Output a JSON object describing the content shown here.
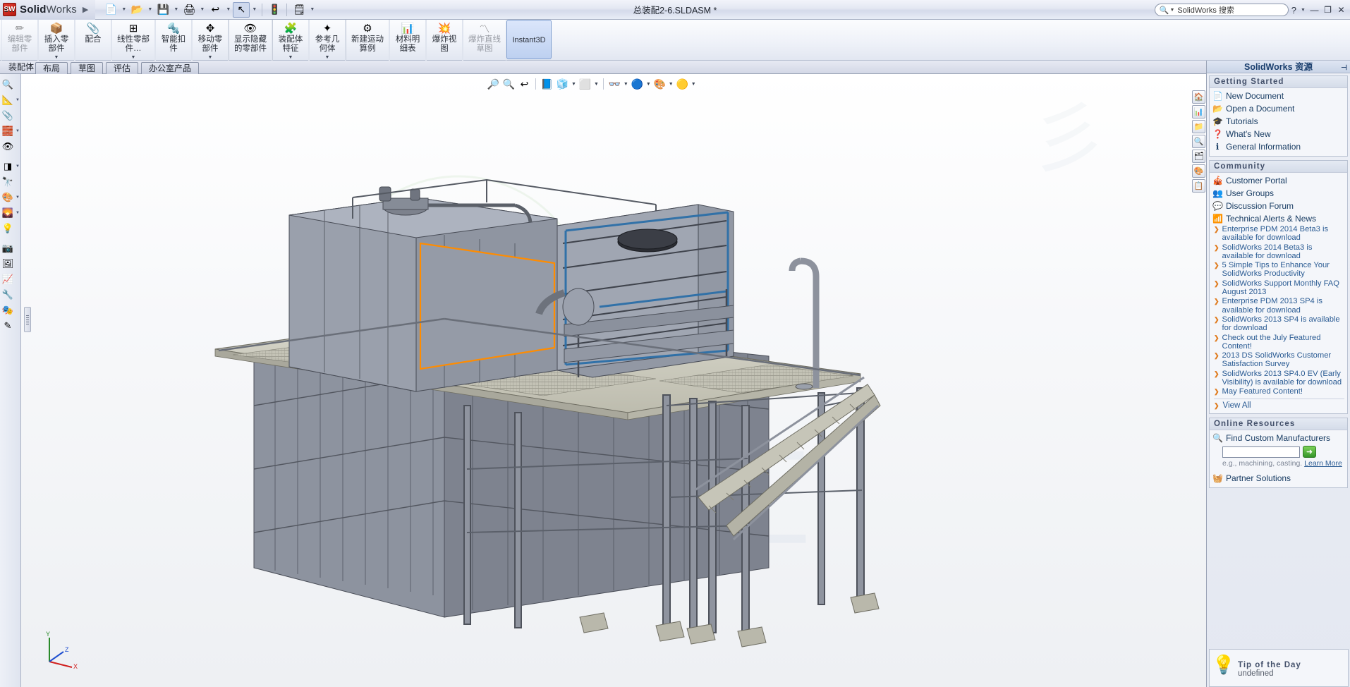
{
  "titlebar": {
    "brand_bold": "Solid",
    "brand_light": "Works",
    "brand_badge": "SW",
    "document_title": "总装配2-6.SLDASM *",
    "tools": [
      {
        "name": "new-document",
        "glyph": "📄",
        "caret": true
      },
      {
        "name": "open-document",
        "glyph": "📂",
        "caret": true
      },
      {
        "name": "save",
        "glyph": "💾",
        "caret": true
      },
      {
        "name": "print",
        "glyph": "🖨",
        "caret": true
      },
      {
        "name": "undo",
        "glyph": "↩",
        "caret": true
      },
      {
        "name": "select",
        "glyph": "↖",
        "caret": true
      },
      {
        "name": "rebuild",
        "glyph": "🚦",
        "caret": false
      },
      {
        "name": "options",
        "glyph": "🗒",
        "caret": true
      }
    ],
    "search_placeholder": "SolidWorks 搜索",
    "help_label": "?",
    "minimize": "—",
    "restore": "❐",
    "close": "✕"
  },
  "ribbon": {
    "items": [
      {
        "label": "编辑零部件",
        "icon": "✏",
        "dropdown": false,
        "disabled": true,
        "active": false
      },
      {
        "label": "插入零部件",
        "icon": "📦",
        "dropdown": true,
        "disabled": false,
        "active": false
      },
      {
        "label": "配合",
        "icon": "📎",
        "dropdown": false,
        "disabled": false,
        "active": false
      },
      {
        "label": "线性零部件…",
        "icon": "⊞",
        "dropdown": true,
        "disabled": false,
        "active": false
      },
      {
        "label": "智能扣件",
        "icon": "🔩",
        "dropdown": false,
        "disabled": false,
        "active": false
      },
      {
        "label": "移动零部件",
        "icon": "✥",
        "dropdown": true,
        "disabled": false,
        "active": false
      },
      {
        "label": "显示隐藏的零部件",
        "icon": "👁",
        "dropdown": false,
        "disabled": false,
        "active": false
      },
      {
        "label": "装配体特征",
        "icon": "🧩",
        "dropdown": true,
        "disabled": false,
        "active": false
      },
      {
        "label": "参考几何体",
        "icon": "✦",
        "dropdown": true,
        "disabled": false,
        "active": false
      },
      {
        "label": "新建运动算例",
        "icon": "⚙",
        "dropdown": false,
        "disabled": false,
        "active": false
      },
      {
        "label": "材料明细表",
        "icon": "📊",
        "dropdown": false,
        "disabled": false,
        "active": false
      },
      {
        "label": "爆炸视图",
        "icon": "💥",
        "dropdown": false,
        "disabled": false,
        "active": false
      },
      {
        "label": "爆炸直线草图",
        "icon": "〽",
        "dropdown": false,
        "disabled": true,
        "active": false
      },
      {
        "label": "Instant3D",
        "icon": "",
        "dropdown": false,
        "disabled": false,
        "active": true
      }
    ]
  },
  "tabs": [
    {
      "label": "装配体",
      "active": true
    },
    {
      "label": "布局",
      "active": false
    },
    {
      "label": "草图",
      "active": false
    },
    {
      "label": "评估",
      "active": false
    },
    {
      "label": "办公室产品",
      "active": false
    }
  ],
  "left_toolbar": [
    {
      "name": "filter-icon",
      "glyph": "🔍",
      "caret": false
    },
    {
      "name": "measure-icon",
      "glyph": "📐",
      "caret": true
    },
    {
      "name": "mate-icon",
      "glyph": "📎",
      "caret": false
    },
    {
      "name": "component-icon",
      "glyph": "🧱",
      "caret": true
    },
    {
      "name": "hidden-icon",
      "glyph": "👁",
      "caret": false
    },
    {
      "name": "section-icon",
      "glyph": "◨",
      "caret": true
    },
    {
      "name": "view-icon",
      "glyph": "🔭",
      "caret": false
    },
    {
      "name": "appearance-icon",
      "glyph": "🎨",
      "caret": true
    },
    {
      "name": "scene-icon",
      "glyph": "🌄",
      "caret": true
    },
    {
      "name": "light-icon",
      "glyph": "💡",
      "caret": false
    },
    {
      "name": "camera-icon",
      "glyph": "📷",
      "caret": false
    },
    {
      "name": "render-icon",
      "glyph": "🖼",
      "caret": false
    },
    {
      "name": "sim-icon",
      "glyph": "📈",
      "caret": false
    },
    {
      "name": "tool-icon",
      "glyph": "🔧",
      "caret": false
    },
    {
      "name": "palette-icon",
      "glyph": "🎭",
      "caret": false
    },
    {
      "name": "sketch-icon",
      "glyph": "✎",
      "caret": false
    }
  ],
  "view_toolbar": [
    {
      "name": "zoom-to-fit-icon",
      "glyph": "🔎",
      "caret": false
    },
    {
      "name": "zoom-to-area-icon",
      "glyph": "🔍",
      "caret": false
    },
    {
      "name": "previous-view-icon",
      "glyph": "↩",
      "caret": false
    },
    {
      "name": "section-view-icon",
      "glyph": "📘",
      "caret": false
    },
    {
      "name": "view-orientation-icon",
      "glyph": "🧊",
      "caret": true
    },
    {
      "name": "display-style-icon",
      "glyph": "⬜",
      "caret": true
    },
    {
      "name": "hide-show-icon",
      "glyph": "👓",
      "caret": true
    },
    {
      "name": "apply-scene-icon",
      "glyph": "🔵",
      "caret": true
    },
    {
      "name": "view-settings-icon",
      "glyph": "🎨",
      "caret": true
    },
    {
      "name": "appearance-icon",
      "glyph": "🟡",
      "caret": true
    }
  ],
  "right_dock": [
    {
      "name": "home-icon",
      "glyph": "🏠"
    },
    {
      "name": "design-library-icon",
      "glyph": "📊"
    },
    {
      "name": "file-explorer-icon",
      "glyph": "📁"
    },
    {
      "name": "search-icon",
      "glyph": "🔍"
    },
    {
      "name": "view-palette-icon",
      "glyph": "🗂"
    },
    {
      "name": "appearances-icon",
      "glyph": "🎨"
    },
    {
      "name": "custom-properties-icon",
      "glyph": "📋"
    }
  ],
  "task_pane": {
    "title": "SolidWorks 资源",
    "groups": [
      {
        "heading": "Getting Started",
        "links": [
          {
            "label": "New Document",
            "icon": "📄"
          },
          {
            "label": "Open a Document",
            "icon": "📂"
          },
          {
            "label": "Tutorials",
            "icon": "🎓"
          },
          {
            "label": "What's New",
            "icon": "❓"
          },
          {
            "label": "General Information",
            "icon": "ℹ"
          }
        ]
      },
      {
        "heading": "Community",
        "links": [
          {
            "label": "Customer Portal",
            "icon": "🎪"
          },
          {
            "label": "User Groups",
            "icon": "👥"
          },
          {
            "label": "Discussion Forum",
            "icon": "💬"
          },
          {
            "label": "Technical Alerts & News",
            "icon": "📶"
          }
        ],
        "news": [
          "Enterprise PDM 2014 Beta3 is available for download",
          "SolidWorks 2014 Beta3 is available for download",
          "5 Simple Tips to Enhance Your SolidWorks Productivity",
          "SolidWorks Support Monthly FAQ August 2013",
          "Enterprise PDM 2013 SP4 is available for download",
          "SolidWorks 2013 SP4 is available for download",
          "Check out the July Featured Content!",
          "2013 DS SolidWorks Customer Satisfaction Survey",
          "SolidWorks 2013 SP4.0 EV (Early Visibility) is available for download",
          "May Featured Content!"
        ],
        "view_all": "View All"
      },
      {
        "heading": "Online Resources",
        "find_label": "Find Custom Manufacturers",
        "find_value": "",
        "find_go": "➜",
        "hint_prefix": "e.g., machining, casting. ",
        "hint_link": "Learn More",
        "links": [
          {
            "label": "Partner Solutions",
            "icon": "🧺"
          }
        ]
      }
    ],
    "tip": {
      "heading": "Tip of the Day",
      "text": "undefined",
      "icon": "💡"
    }
  },
  "viewport": {
    "watermark": "飞机汇",
    "triad": {
      "x": "X",
      "y": "Y",
      "z": "Z"
    }
  },
  "colors": {
    "accent": "#1b3f6e",
    "link": "#2a5b93",
    "news_caret": "#e07b1e",
    "titlebar_grad_top": "#f2f4fa",
    "selection_orange": "#ff8c00",
    "model_body": "#8a8f9b",
    "model_deck": "#cfcec2"
  }
}
